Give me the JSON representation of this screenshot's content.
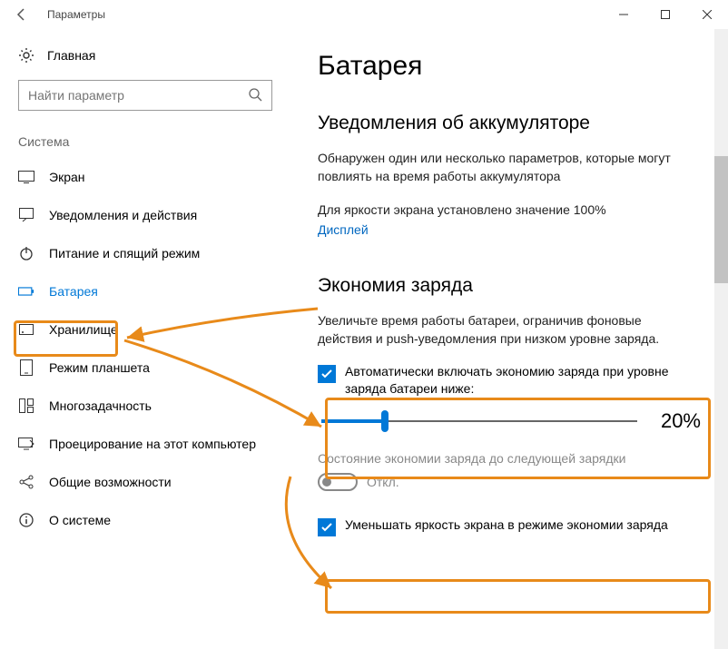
{
  "window": {
    "title": "Параметры"
  },
  "sidebar": {
    "home": "Главная",
    "search_placeholder": "Найти параметр",
    "category": "Система",
    "items": [
      {
        "icon": "display",
        "label": "Экран"
      },
      {
        "icon": "notify",
        "label": "Уведомления и действия"
      },
      {
        "icon": "power",
        "label": "Питание и спящий режим"
      },
      {
        "icon": "battery",
        "label": "Батарея",
        "selected": true
      },
      {
        "icon": "storage",
        "label": "Хранилище"
      },
      {
        "icon": "tablet",
        "label": "Режим планшета"
      },
      {
        "icon": "multitask",
        "label": "Многозадачность"
      },
      {
        "icon": "project",
        "label": "Проецирование на этот компьютер"
      },
      {
        "icon": "shared",
        "label": "Общие возможности"
      },
      {
        "icon": "about",
        "label": "О системе"
      }
    ]
  },
  "content": {
    "page_title": "Батарея",
    "notifications": {
      "heading": "Уведомления об аккумуляторе",
      "body": "Обнаружен один или несколько параметров, которые могут повлиять на время работы аккумулятора",
      "brightness_line": "Для яркости экрана установлено значение 100%",
      "link_display": "Дисплей"
    },
    "saver": {
      "heading": "Экономия заряда",
      "desc": "Увеличьте время работы батареи, ограничив фоновые действия и push-уведомления при низком уровне заряда.",
      "auto_check_label": "Автоматически включать экономию заряда при уровне заряда батареи ниже:",
      "slider_value": "20%",
      "until_next_label": "Состояние экономии заряда до следующей зарядки",
      "toggle_state": "Откл.",
      "dim_check_label": "Уменьшать яркость экрана в режиме экономии заряда"
    }
  }
}
